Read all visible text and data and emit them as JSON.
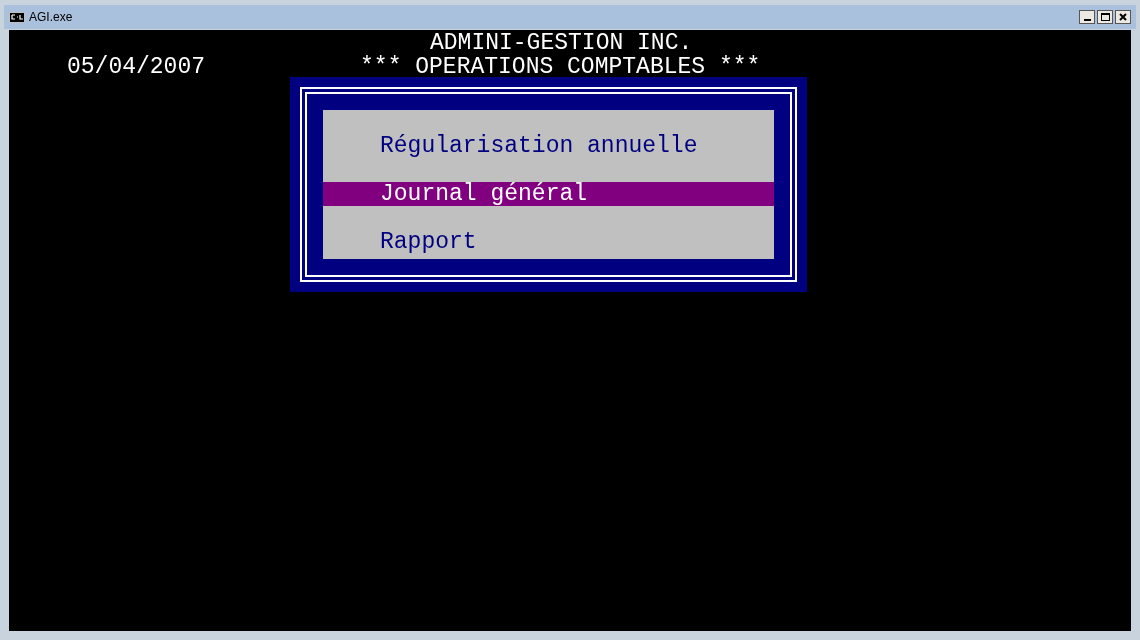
{
  "window": {
    "title": "AGI.exe"
  },
  "header": {
    "company": "ADMINI-GESTION INC.",
    "date": "05/04/2007",
    "subtitle": "*** OPERATIONS COMPTABLES ***"
  },
  "menu": {
    "items": [
      {
        "label": "Régularisation annuelle",
        "selected": false
      },
      {
        "label": "Journal général",
        "selected": true
      },
      {
        "label": "Rapport",
        "selected": false
      }
    ]
  }
}
